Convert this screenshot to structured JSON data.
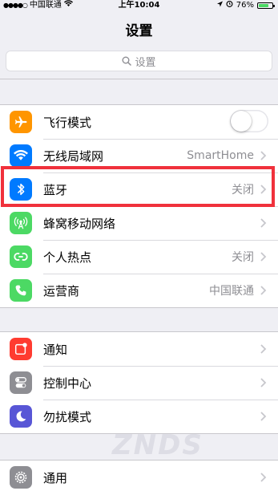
{
  "status_bar": {
    "carrier": "中国联通",
    "time": "上午10:04",
    "battery": "76%",
    "battery_level": 0.76
  },
  "nav": {
    "title": "设置"
  },
  "search": {
    "placeholder": "设置"
  },
  "groups": [
    {
      "items": [
        {
          "label": "飞行模式",
          "icon": "airplane-icon",
          "icon_color": "#ff9500",
          "toggle": false
        },
        {
          "label": "无线局域网",
          "icon": "wifi-icon",
          "icon_color": "#007aff",
          "value": "SmartHome"
        },
        {
          "label": "蓝牙",
          "icon": "bluetooth-icon",
          "icon_color": "#007aff",
          "value": "关闭"
        },
        {
          "label": "蜂窝移动网络",
          "icon": "cellular-icon",
          "icon_color": "#4cd964"
        },
        {
          "label": "个人热点",
          "icon": "hotspot-icon",
          "icon_color": "#4cd964",
          "value": "关闭"
        },
        {
          "label": "运营商",
          "icon": "phone-icon",
          "icon_color": "#4cd964",
          "value": "中国联通"
        }
      ]
    },
    {
      "items": [
        {
          "label": "通知",
          "icon": "notifications-icon",
          "icon_color": "#ff3b30"
        },
        {
          "label": "控制中心",
          "icon": "control-center-icon",
          "icon_color": "#8e8e93"
        },
        {
          "label": "勿扰模式",
          "icon": "moon-icon",
          "icon_color": "#5856d6"
        }
      ]
    },
    {
      "items": [
        {
          "label": "通用",
          "icon": "gear-icon",
          "icon_color": "#8e8e93"
        }
      ]
    }
  ],
  "highlight_color": "#f0313c",
  "watermark": "ZNDS"
}
